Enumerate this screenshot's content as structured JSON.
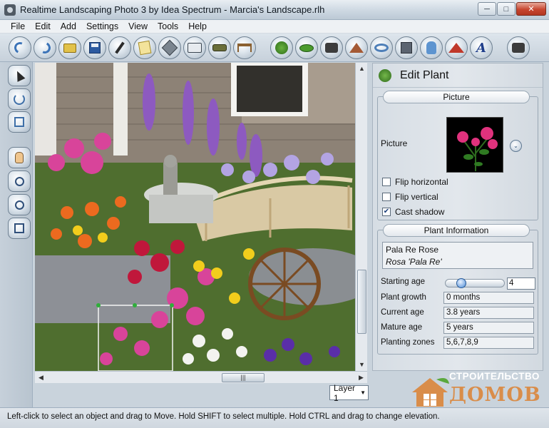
{
  "window": {
    "title": "Realtime Landscaping Photo 3 by Idea Spectrum - Marcia's Landscape.rlh",
    "minimize": "0",
    "maximize": "1",
    "close": "r"
  },
  "menu": [
    "File",
    "Edit",
    "Add",
    "Settings",
    "View",
    "Tools",
    "Help"
  ],
  "toolbar": [
    {
      "name": "new-project-button",
      "icon": "arc-icon"
    },
    {
      "name": "open-button",
      "icon": "arc-icon"
    },
    {
      "name": "open-folder-button",
      "icon": "folder-icon"
    },
    {
      "name": "save-button",
      "icon": "disk-icon"
    },
    {
      "name": "draw-button",
      "icon": "pen-icon"
    },
    {
      "name": "notes-button",
      "icon": "note-icon"
    },
    {
      "name": "shape-button",
      "icon": "diamond-icon"
    },
    {
      "name": "print-button",
      "icon": "printer-icon"
    },
    {
      "name": "pad-button",
      "icon": "pad-icon"
    },
    {
      "name": "table-button",
      "icon": "table-icon"
    },
    {
      "name": "add-plant-button",
      "icon": "tree-icon"
    },
    {
      "name": "add-shrub-button",
      "icon": "leaf-icon"
    },
    {
      "name": "camera-button",
      "icon": "camera-icon"
    },
    {
      "name": "add-structure-button",
      "icon": "roof-icon"
    },
    {
      "name": "add-edging-button",
      "icon": "ring-icon"
    },
    {
      "name": "add-object-button",
      "icon": "box-icon"
    },
    {
      "name": "add-fixture-button",
      "icon": "hand-icon"
    },
    {
      "name": "add-terrain-button",
      "icon": "mountain-icon"
    },
    {
      "name": "add-text-button",
      "icon": "text-icon",
      "glyph": "A"
    },
    {
      "name": "preview-button",
      "icon": "camera-icon"
    }
  ],
  "sidebar_tools": [
    {
      "name": "select-tool",
      "icon": "cursor-icon"
    },
    {
      "name": "rotate-tool",
      "icon": "rotate-icon"
    },
    {
      "name": "scale-tool",
      "icon": "scale-icon"
    },
    {
      "name": "pan-tool",
      "icon": "hand-icon"
    },
    {
      "name": "zoom-tool",
      "icon": "magnifier-icon"
    },
    {
      "name": "zoom-fit-tool",
      "icon": "magnifier-icon"
    },
    {
      "name": "zoom-window-tool",
      "icon": "magnifier-square-icon"
    }
  ],
  "panel": {
    "title": "Edit Plant",
    "picture_section": "Picture",
    "picture_label": "Picture",
    "dropdown_glyph": "⌄",
    "flip_horizontal": "Flip horizontal",
    "flip_vertical": "Flip vertical",
    "cast_shadow": "Cast shadow",
    "flip_horizontal_checked": false,
    "flip_vertical_checked": false,
    "cast_shadow_checked": true,
    "check_mark": "✔",
    "info_section": "Plant Information",
    "common_name": "Pala Re Rose",
    "scientific_name": "Rosa 'Pala Re'",
    "starting_age_label": "Starting age",
    "starting_age_value": "4",
    "plant_growth_label": "Plant growth",
    "plant_growth_value": "0 months",
    "current_age_label": "Current age",
    "current_age_value": "3.8 years",
    "mature_age_label": "Mature age",
    "mature_age_value": "5 years",
    "planting_zones_label": "Planting zones",
    "planting_zones_value": "5,6,7,8,9"
  },
  "layer": {
    "value": "Layer 1",
    "caret": "▼"
  },
  "scroll": {
    "up": "▲",
    "down": "▼",
    "left": "◀",
    "right": "▶",
    "grip": "|||"
  },
  "status": "Left-click to select an object and drag to Move. Hold SHIFT to select multiple. Hold CTRL and drag to change elevation.",
  "watermark": {
    "line1": "СТРОИТЕЛЬСТВО",
    "line2": "ДОМОВ"
  },
  "colors": {
    "accent": "#3c74b8",
    "wm_orange": "#d98d4a",
    "wm_green": "#5aa83c"
  }
}
